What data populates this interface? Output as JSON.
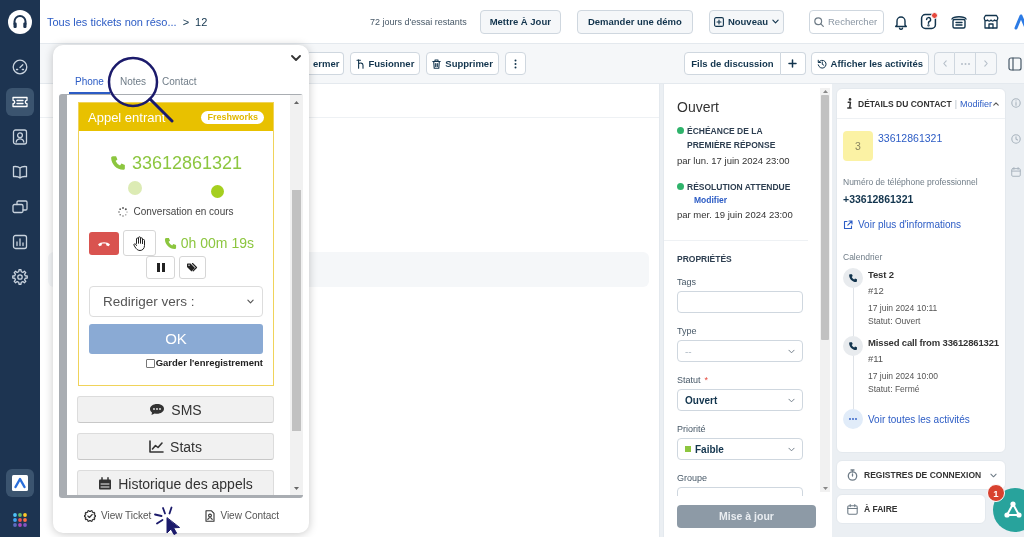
{
  "sidebar": {
    "items": [
      {
        "selected": false
      },
      {
        "selected": true
      },
      {
        "selected": false
      },
      {
        "selected": false
      },
      {
        "selected": false
      },
      {
        "selected": false
      },
      {
        "selected": false
      }
    ]
  },
  "header": {
    "breadcrumb": "Tous les tickets non réso...",
    "separator": ">",
    "ticket_number": "12",
    "trial_notice": "72 jours d'essai restants",
    "buttons": [
      "Mettre À Jour",
      "Demander une démo"
    ],
    "new_button": "Nouveau",
    "search": {
      "placeholder": "Rechercher"
    },
    "help_notification": true
  },
  "toolbar": {
    "actions": [
      {
        "label": "ermer",
        "kind": "plain"
      },
      {
        "label": "Fusionner",
        "kind": "merge"
      },
      {
        "label": "Supprimer",
        "kind": "delete"
      }
    ],
    "thread_button": "Fils de discussion",
    "activities_button": "Afficher les activités"
  },
  "properties_panel": {
    "status": "Ouvert",
    "sla": [
      {
        "label": "ÉCHÉANCE DE LA PREMIÈRE RÉPONSE",
        "due": "par lun. 17 juin 2024 23:00"
      },
      {
        "label": "RÉSOLUTION ATTENDUE",
        "link": "Modifier",
        "due": "par mer. 19 juin 2024 23:00"
      }
    ],
    "section_title": "PROPRIÉTÉS",
    "fields": [
      {
        "label": "Tags",
        "kind": "text"
      },
      {
        "label": "Type",
        "kind": "select",
        "placeholder": "--"
      },
      {
        "label": "Statut",
        "required_mark": "*",
        "kind": "select",
        "value": "Ouvert"
      },
      {
        "label": "Priorité",
        "kind": "select",
        "value": "Faible",
        "color": "#8dc63f"
      },
      {
        "label": "Groupe",
        "kind": "select"
      }
    ],
    "update_button": {
      "label": "Mise à jour",
      "disabled": true
    }
  },
  "contact_panel": {
    "title": "DÉTAILS DU CONTACT",
    "separator": "|",
    "edit_link": "Modifier",
    "avatar": "3",
    "name": "33612861321",
    "phone_label": "Numéro de téléphone professionnel",
    "phone": "+33612861321",
    "more_link": "Voir plus d'informations",
    "timeline_title": "Calendrier",
    "timeline": [
      {
        "title": "Test 2",
        "number": "#12",
        "date": "17 juin 2024 10:11",
        "status": "Statut: Ouvert"
      },
      {
        "title": "Missed call from 33612861321",
        "number": "#11",
        "date": "17 juin 2024 10:00",
        "status": "Statut: Fermé"
      }
    ],
    "all_activities": "Voir toutes les activités"
  },
  "sections": [
    {
      "title": "REGISTRES DE CONNEXION",
      "kind": "logs"
    },
    {
      "title": "À FAIRE",
      "kind": "todo"
    }
  ],
  "phone_widget": {
    "tabs": [
      {
        "label": "Phone",
        "selected": true
      },
      {
        "label": "Notes",
        "selected": false
      },
      {
        "label": "Contact",
        "selected": false
      }
    ],
    "call": {
      "title": "Appel entrant",
      "badge": "Freshworks",
      "number": "33612861321",
      "indicators": [
        {
          "color": "#dcebb4"
        },
        {
          "color": "#a5cf1f"
        }
      ],
      "status": "Conversation en cours",
      "timer": "0h 00m 19s",
      "redirect": {
        "value": "Rediriger vers :"
      },
      "ok_button": "OK",
      "record": {
        "label": "Garder l'enregistrement",
        "checked": false
      }
    },
    "actions": [
      {
        "label": "SMS",
        "kind": "sms"
      },
      {
        "label": "Stats",
        "kind": "stats"
      },
      {
        "label": "Historique des appels",
        "kind": "history"
      }
    ],
    "footer": [
      {
        "label": "View Ticket",
        "kind": "ticket"
      },
      {
        "label": "View Contact",
        "kind": "contact"
      }
    ]
  },
  "chat_launcher": {
    "badge": "1"
  }
}
